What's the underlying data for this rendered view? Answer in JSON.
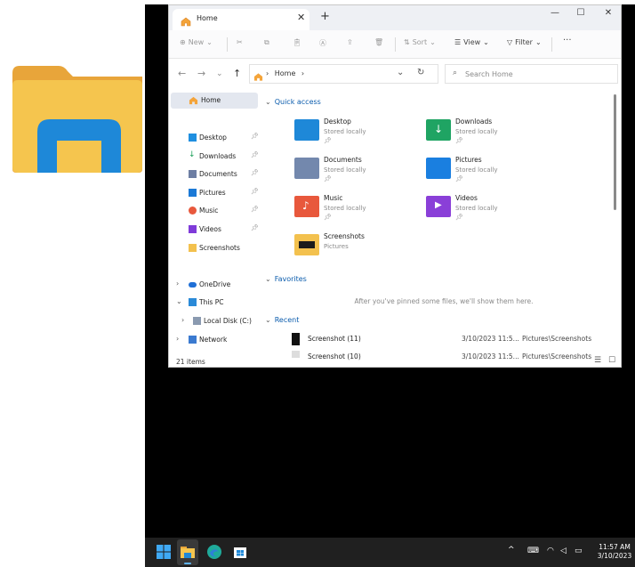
{
  "window": {
    "tab_title": "Home",
    "tab_close": "✕",
    "new_tab": "+",
    "minimize": "—",
    "maximize": "☐",
    "close": "✕"
  },
  "toolbar": {
    "new_label": "New",
    "sort_label": "Sort",
    "view_label": "View",
    "filter_label": "Filter",
    "more": "···"
  },
  "address": {
    "breadcrumb_sep1": "›",
    "breadcrumb_home": "Home",
    "breadcrumb_sep2": "›",
    "search_placeholder": "Search Home"
  },
  "nav": {
    "home": "Home",
    "pinned": [
      {
        "label": "Desktop",
        "icon": "desktop-icon",
        "color": "#1f8fe0"
      },
      {
        "label": "Downloads",
        "icon": "download-icon",
        "color": "#1a9f57"
      },
      {
        "label": "Documents",
        "icon": "documents-icon",
        "color": "#6d7ea3"
      },
      {
        "label": "Pictures",
        "icon": "pictures-icon",
        "color": "#1b79d6"
      },
      {
        "label": "Music",
        "icon": "music-icon",
        "color": "#e8583c"
      },
      {
        "label": "Videos",
        "icon": "videos-icon",
        "color": "#7f3bd9"
      },
      {
        "label": "Screenshots",
        "icon": "folder-icon",
        "color": "#f3c14e"
      }
    ],
    "onedrive": "OneDrive",
    "thispc": "This PC",
    "localdisk": "Local Disk (C:)",
    "network": "Network"
  },
  "main": {
    "quick_access_title": "Quick access",
    "quick_access": [
      {
        "name": "Desktop",
        "sub": "Stored locally",
        "color": "#1e88d8"
      },
      {
        "name": "Downloads",
        "sub": "Stored locally",
        "color": "#1fa463"
      },
      {
        "name": "Documents",
        "sub": "Stored locally",
        "color": "#7388ad"
      },
      {
        "name": "Pictures",
        "sub": "Stored locally",
        "color": "#1a7fe0"
      },
      {
        "name": "Music",
        "sub": "Stored locally",
        "color": "#e8583c"
      },
      {
        "name": "Videos",
        "sub": "Stored locally",
        "color": "#8a3fd8"
      },
      {
        "name": "Screenshots",
        "sub": "Pictures",
        "color": "#f3c14e"
      }
    ],
    "favorites_title": "Favorites",
    "favorites_empty": "After you've pinned some files, we'll show them here.",
    "recent_title": "Recent",
    "recent": [
      {
        "name": "Screenshot (11)",
        "date": "3/10/2023 11:5...",
        "location": "Pictures\\Screenshots"
      },
      {
        "name": "Screenshot (10)",
        "date": "3/10/2023 11:5...",
        "location": "Pictures\\Screenshots"
      }
    ]
  },
  "status": {
    "items": "21 items"
  },
  "taskbar": {
    "time": "11:57 AM",
    "date": "3/10/2023",
    "tray_chevron": "^"
  }
}
